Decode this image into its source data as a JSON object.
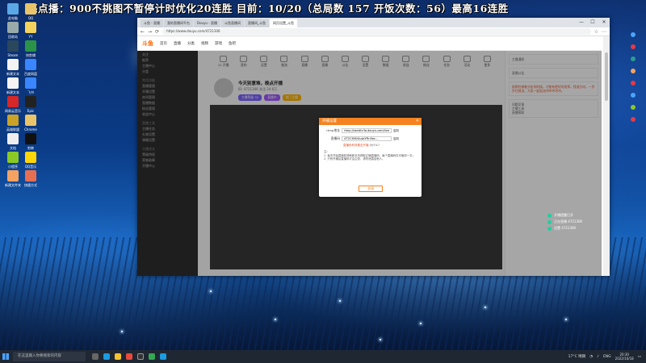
{
  "banner": {
    "text": "亮点播：900不挑图不暂停计时优化20连胜   目前：10/20（总局数 157 开饭次数：56）最高16连胜"
  },
  "desktop_icons": [
    {
      "label": "此电脑",
      "color": "#5aa9e6"
    },
    {
      "label": "QQ",
      "color": "#e9c46a"
    },
    {
      "label": "回收站",
      "color": "#9aa"
    },
    {
      "label": "YY",
      "color": "#f4d35e"
    },
    {
      "label": "Steam",
      "color": "#2a475e"
    },
    {
      "label": "快剪辑",
      "color": "#2b9348"
    },
    {
      "label": "新建文本",
      "color": "#f4f4f4"
    },
    {
      "label": "百度网盘",
      "color": "#3a86ff"
    },
    {
      "label": "新建文本",
      "color": "#f4f4f4"
    },
    {
      "label": "飞书",
      "color": "#3a86ff"
    },
    {
      "label": "网易云音乐",
      "color": "#d62828"
    },
    {
      "label": "Epic",
      "color": "#222"
    },
    {
      "label": "英雄联盟",
      "color": "#c9a227"
    },
    {
      "label": "Chrome",
      "color": "#e9c46a"
    },
    {
      "label": "文档",
      "color": "#eee"
    },
    {
      "label": "剪映",
      "color": "#111"
    },
    {
      "label": "小程序",
      "color": "#8ac926"
    },
    {
      "label": "QQ音乐",
      "color": "#ffd60a"
    },
    {
      "label": "新建文件夹",
      "color": "#f4a261"
    },
    {
      "label": "快捷方式",
      "color": "#e76f51"
    }
  ],
  "browser": {
    "tabs": [
      "斗鱼 - 直播",
      "我的直播间平台",
      "Douyu - 直播",
      "斗鱼直播间",
      "直播间_斗鱼",
      "网页设置_斗鱼"
    ],
    "url": "https://www.douyu.com/4721306",
    "window_controls": [
      "—",
      "☐",
      "✕"
    ]
  },
  "site": {
    "logo": "斗鱼",
    "nav": [
      "首页",
      "直播",
      "分类",
      "视频",
      "游戏",
      "鱼吧"
    ],
    "sidebar": [
      {
        "label": "关注"
      },
      {
        "label": "推荐"
      },
      {
        "label": "主播中心"
      },
      {
        "label": "分类"
      },
      {
        "label": "常用功能",
        "header": true
      },
      {
        "label": "直播管理"
      },
      {
        "label": "开播设置"
      },
      {
        "label": "房间管理"
      },
      {
        "label": "直播数据"
      },
      {
        "label": "粉丝管理"
      },
      {
        "label": "收益中心"
      },
      {
        "label": "直播工具",
        "header": true
      },
      {
        "label": "主播任务"
      },
      {
        "label": "礼物设置"
      },
      {
        "label": "弹幕设置"
      },
      {
        "label": "主播成长",
        "header": true
      },
      {
        "label": "等级特权"
      },
      {
        "label": "荣誉勋章"
      },
      {
        "label": "开播中心"
      }
    ],
    "toolbar": [
      "12 开播",
      "我的",
      "设置",
      "推流",
      "直播",
      "直播",
      "公告",
      "设置",
      "数据",
      "收益",
      "粉丝",
      "任务",
      "活动",
      "更多"
    ],
    "profile": {
      "title": "今天别意难，晚点开播",
      "sub": "ID: 4721306  关注 24.6万",
      "tags": [
        {
          "text": "主播等级 32",
          "color": "#7b61ff"
        },
        {
          "text": "直播中",
          "color": "#a259ff"
        },
        {
          "text": "热门主播",
          "color": "#ffb400"
        }
      ]
    },
    "right": {
      "box1": "主播通知",
      "box2": "直播公告",
      "notice": "前期在做着分析的时候，才能有更好的发挥。找准方向，一步步往前进，大家一起加油冲冲冲冲冲。",
      "links": [
        "问题反馈",
        "主播工具",
        "直播帮助"
      ]
    }
  },
  "modal": {
    "title": "开播设置",
    "close": "✕",
    "rtmp_label": "rtmp地址",
    "rtmp_value": "rtmp://sendtc3a.douyu.com/live",
    "copy": "复制",
    "key_label": "直播码",
    "key_value": "4721306rSusbYFin5ec...",
    "copy2": "复制",
    "hint": "直播码有效期至开播",
    "hint_link": "为什么?",
    "notes": "注：\n1. 每次开始直播前请刷新本页获取正确直播码，每个直播码仅可使用一次；\n2. 只有开播后直播码才会生效，请勿泄露给他人。",
    "confirm": "关闭"
  },
  "float_tray": [
    "开播提醒已开",
    "正在直播 4721306",
    "设置 4721306"
  ],
  "taskbar": {
    "search_placeholder": "在这里输入你要搜索的内容",
    "temp": "17°C 晴朗",
    "lang": "ENG",
    "time": "20:30",
    "date": "2022/10/18"
  }
}
